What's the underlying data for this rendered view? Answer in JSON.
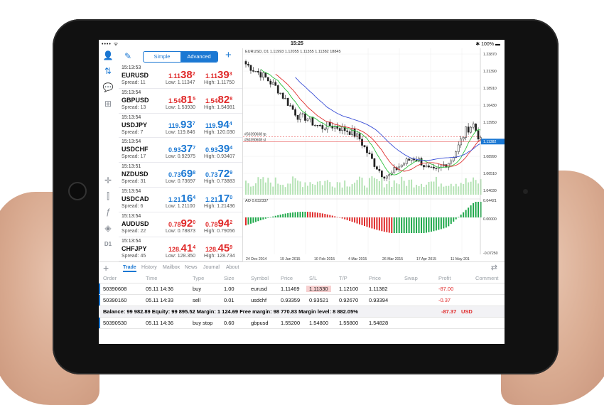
{
  "status": {
    "carrier": "•••• ",
    "wifi_icon": "wifi-icon",
    "time": "15:25",
    "battery": "100%"
  },
  "header": {
    "simple": "Simple",
    "advanced": "Advanced"
  },
  "quotes": [
    {
      "time": "15:13:53",
      "symbol": "EURUSD",
      "spread": "Spread: 11",
      "bid_pre": "1.11",
      "bid_big": "38",
      "bid_sup": "2",
      "bid_color": "red",
      "ask_pre": "1.11",
      "ask_big": "39",
      "ask_sup": "3",
      "ask_color": "red",
      "low": "Low: 1.11347",
      "high": "High: 1.11750"
    },
    {
      "time": "15:13:54",
      "symbol": "GBPUSD",
      "spread": "Spread: 13",
      "bid_pre": "1.54",
      "bid_big": "81",
      "bid_sup": "5",
      "bid_color": "red",
      "ask_pre": "1.54",
      "ask_big": "82",
      "ask_sup": "8",
      "ask_color": "red",
      "low": "Low: 1.53930",
      "high": "High: 1.54981"
    },
    {
      "time": "15:13:54",
      "symbol": "USDJPY",
      "spread": "Spread: 7",
      "bid_pre": "119.",
      "bid_big": "93",
      "bid_sup": "7",
      "bid_color": "blue",
      "ask_pre": "119.",
      "ask_big": "94",
      "ask_sup": "4",
      "ask_color": "blue",
      "low": "Low: 119.846",
      "high": "High: 120.030"
    },
    {
      "time": "15:13:54",
      "symbol": "USDCHF",
      "spread": "Spread: 17",
      "bid_pre": "0.93",
      "bid_big": "37",
      "bid_sup": "7",
      "bid_color": "blue",
      "ask_pre": "0.93",
      "ask_big": "39",
      "ask_sup": "4",
      "ask_color": "blue",
      "low": "Low: 0.92975",
      "high": "High: 0.93407"
    },
    {
      "time": "15:13:51",
      "symbol": "NZDUSD",
      "spread": "Spread: 31",
      "bid_pre": "0.73",
      "bid_big": "69",
      "bid_sup": "8",
      "bid_color": "blue",
      "ask_pre": "0.73",
      "ask_big": "72",
      "ask_sup": "9",
      "ask_color": "blue",
      "low": "Low: 0.73697",
      "high": "High: 0.73883"
    },
    {
      "time": "15:13:54",
      "symbol": "USDCAD",
      "spread": "Spread: 6",
      "bid_pre": "1.21",
      "bid_big": "16",
      "bid_sup": "4",
      "bid_color": "blue",
      "ask_pre": "1.21",
      "ask_big": "17",
      "ask_sup": "0",
      "ask_color": "blue",
      "low": "Low: 1.21100",
      "high": "High: 1.21436"
    },
    {
      "time": "15:13:54",
      "symbol": "AUDUSD",
      "spread": "Spread: 22",
      "bid_pre": "0.78",
      "bid_big": "92",
      "bid_sup": "0",
      "bid_color": "red",
      "ask_pre": "0.78",
      "ask_big": "94",
      "ask_sup": "2",
      "ask_color": "red",
      "low": "Low: 0.78873",
      "high": "High: 0.79056"
    },
    {
      "time": "15:13:54",
      "symbol": "CHFJPY",
      "spread": "Spread: 45",
      "bid_pre": "128.",
      "bid_big": "41",
      "bid_sup": "4",
      "bid_color": "red",
      "ask_pre": "128.",
      "ask_big": "45",
      "ask_sup": "9",
      "ask_color": "red",
      "low": "Low: 128.350",
      "high": "High: 128.734"
    }
  ],
  "chart": {
    "symbol_label": "EURUSD, D1  1.11993 1.12055 1.11355 1.11382 18845",
    "ao_label": "AO 0.032337",
    "order_labels": [
      "#50390608 tp",
      "#50390608 sl"
    ],
    "price_ticks": [
      "1.23870",
      "1.21390",
      "1.18910",
      "1.16430",
      "1.13950",
      "1.11382",
      "1.08990",
      "1.06510",
      "1.04030"
    ],
    "ao_ticks": [
      "0.04421",
      "0.00000",
      "-0.07250"
    ],
    "date_ticks": [
      "24 Dec 2014",
      "19 Jan 2015",
      "10 Feb 2015",
      "4 Mar 2015",
      "26 Mar 2015",
      "17 Apr 2015",
      "11 May 201"
    ],
    "colors": {
      "bull": "#1ea84a",
      "bear": "#e02a2a",
      "ma_blue": "#3a4fd6",
      "ma_red": "#e03030",
      "ma_green": "#2cbf3c",
      "current": "#1b78d3"
    }
  },
  "tabs": {
    "items": [
      "Trade",
      "History",
      "Mailbox",
      "News",
      "Journal",
      "About"
    ]
  },
  "table": {
    "headers": [
      "Order",
      "Time",
      "Type",
      "Size",
      "Symbol",
      "Price",
      "S/L",
      "T/P",
      "Price",
      "Swap",
      "Profit",
      "Comment"
    ],
    "rows": [
      [
        "50390608",
        "05.11 14:36",
        "buy",
        "1.00",
        "eurusd",
        "1.11469",
        "1.11330",
        "1.12100",
        "1.11382",
        "",
        "-87.00",
        ""
      ],
      [
        "50390160",
        "05.11 14:33",
        "sell",
        "0.01",
        "usdchf",
        "0.93359",
        "0.93521",
        "0.92670",
        "0.93394",
        "",
        "-0.37",
        ""
      ]
    ],
    "balance": "Balance: 99 982.89 Equity: 99 895.52 Margin: 1 124.69 Free margin: 98 770.83 Margin level: 8 882.05%",
    "balance_profit": "-87.37",
    "balance_currency": "USD",
    "pending": [
      "50390530",
      "05.11 14:36",
      "buy stop",
      "0.60",
      "gbpusd",
      "1.55200",
      "1.54800",
      "1.55800",
      "1.54828",
      "",
      "",
      ""
    ]
  },
  "chart_data": {
    "type": "candlestick",
    "series": [
      {
        "name": "EURUSD",
        "values": [
          1.23,
          1.222,
          1.215,
          1.205,
          1.195,
          1.18,
          1.165,
          1.15,
          1.15,
          1.14,
          1.135,
          1.138,
          1.136,
          1.132,
          1.128,
          1.118,
          1.098,
          1.08,
          1.065,
          1.062,
          1.075,
          1.082,
          1.09,
          1.085,
          1.072,
          1.068,
          1.078,
          1.085,
          1.105,
          1.13,
          1.14,
          1.11382
        ]
      }
    ]
  }
}
